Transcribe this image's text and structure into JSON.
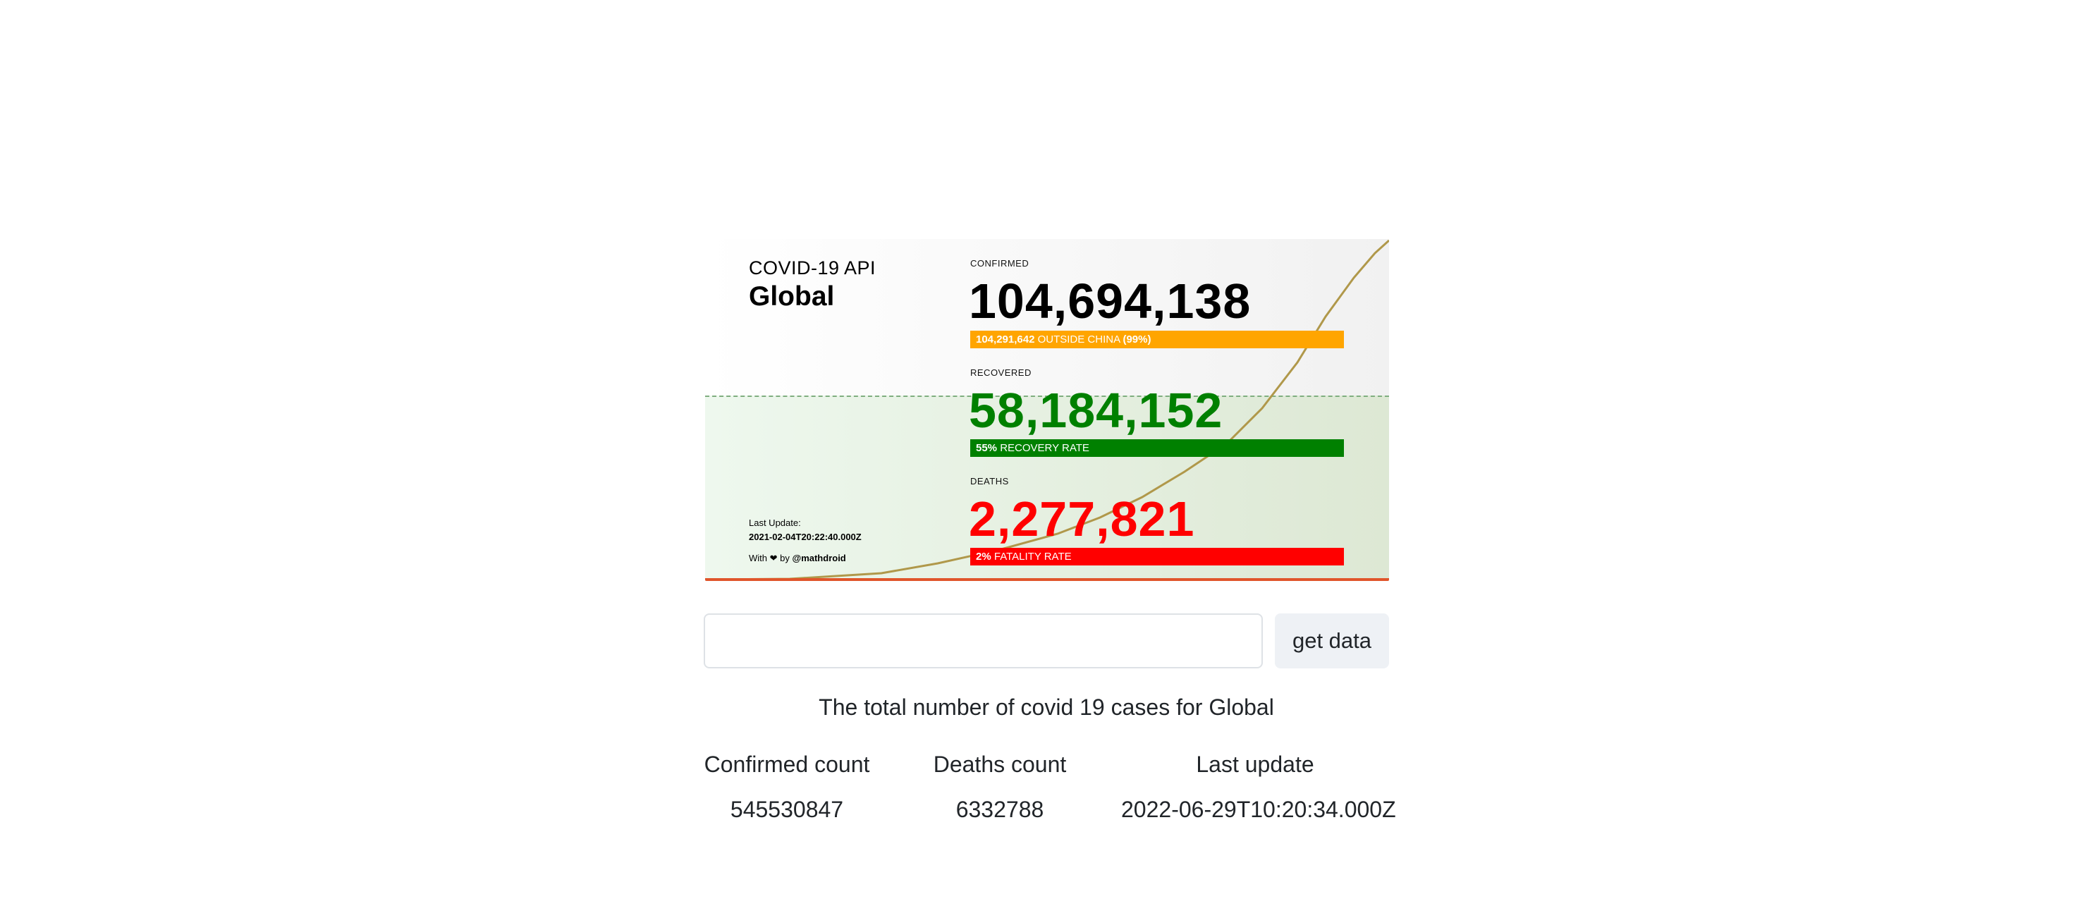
{
  "card": {
    "api_label": "COVID-19 API",
    "region": "Global",
    "confirmed": {
      "label": "CONFIRMED",
      "value": "104,694,138",
      "bar_count": "104,291,642",
      "bar_text": "OUTSIDE CHINA",
      "bar_pct": "(99%)",
      "color": "#000000",
      "bar_color": "#ffa500"
    },
    "recovered": {
      "label": "RECOVERED",
      "value": "58,184,152",
      "bar_pct": "55%",
      "bar_text": "RECOVERY RATE",
      "color": "#008000",
      "bar_color": "#008000"
    },
    "deaths": {
      "label": "DEATHS",
      "value": "2,277,821",
      "bar_pct": "2%",
      "bar_text": "FATALITY RATE",
      "color": "#ff0000",
      "bar_color": "#ff0000"
    },
    "last_update_label": "Last Update:",
    "last_update_value": "2021-02-04T20:22:40.000Z",
    "credit_prefix": "With",
    "credit_heart": "❤",
    "credit_by": "by",
    "credit_author": "@mathdroid"
  },
  "form": {
    "input_value": "",
    "button_label": "get data"
  },
  "results": {
    "caption": "The total number of covid 19 cases for Global",
    "headers": [
      "Confirmed count",
      "Deaths count",
      "Last update"
    ],
    "values": [
      "545530847",
      "6332788",
      "2022-06-29T10:20:34.000Z"
    ]
  }
}
